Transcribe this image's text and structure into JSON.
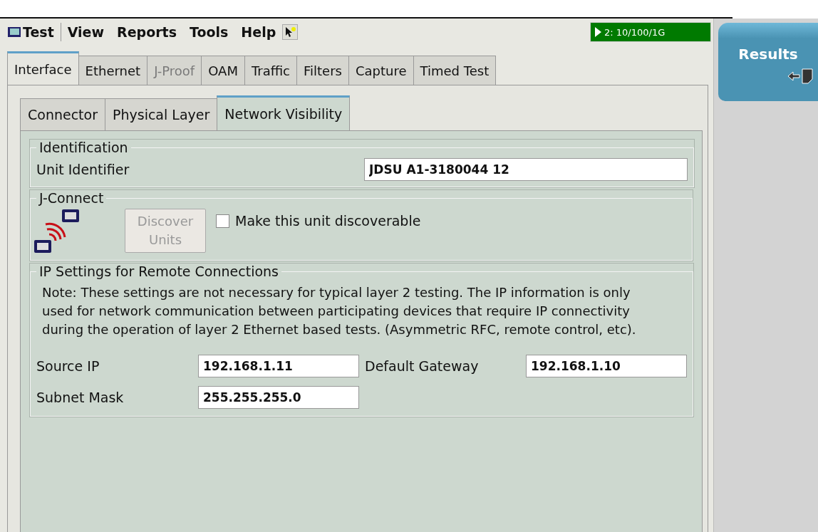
{
  "menu": [
    {
      "label": "Test",
      "kind": "app"
    },
    {
      "label": "View",
      "kind": "plain"
    },
    {
      "label": "Reports",
      "kind": "plain"
    },
    {
      "label": "Tools",
      "kind": "plain"
    },
    {
      "label": "Help",
      "kind": "plain"
    },
    {
      "kind": "whatsthis"
    }
  ],
  "port_status": {
    "label": "2: 10/100/1G"
  },
  "tabs": [
    {
      "label": "Interface",
      "selected": true,
      "disabled": false
    },
    {
      "label": "Ethernet",
      "selected": false,
      "disabled": false
    },
    {
      "label": "J-Proof",
      "selected": false,
      "disabled": true
    },
    {
      "label": "OAM",
      "selected": false,
      "disabled": false
    },
    {
      "label": "Traffic",
      "selected": false,
      "disabled": false
    },
    {
      "label": "Filters",
      "selected": false,
      "disabled": false
    },
    {
      "label": "Capture",
      "selected": false,
      "disabled": false
    },
    {
      "label": "Timed Test",
      "selected": false,
      "disabled": false
    }
  ],
  "subtabs": [
    {
      "label": "Connector",
      "selected": false
    },
    {
      "label": "Physical Layer",
      "selected": false
    },
    {
      "label": "Network Visibility",
      "selected": true
    }
  ],
  "identification": {
    "title": "Identification",
    "label": "Unit Identifier",
    "value": "JDSU A1-3180044 12"
  },
  "jconnect": {
    "title": "J-Connect",
    "button": {
      "label": "Discover Units",
      "disabled": true
    },
    "checkbox": {
      "label": "Make this unit discoverable",
      "checked": false
    }
  },
  "ip_settings": {
    "title": "IP Settings for Remote Connections",
    "note": "Note: These settings are not necessary for typical layer 2 testing. The IP information is only used for network communication between participating devices that require IP connectivity during the operation of layer 2 Ethernet based tests. (Asymmetric RFC, remote control, etc).",
    "fields": [
      {
        "label": "Source IP",
        "value": "192.168.1.11"
      },
      {
        "label": "Default Gateway",
        "value": "192.168.1.10"
      },
      {
        "label": "Subnet Mask",
        "value": "255.255.255.0"
      }
    ]
  },
  "side": {
    "results_button": "Results"
  }
}
